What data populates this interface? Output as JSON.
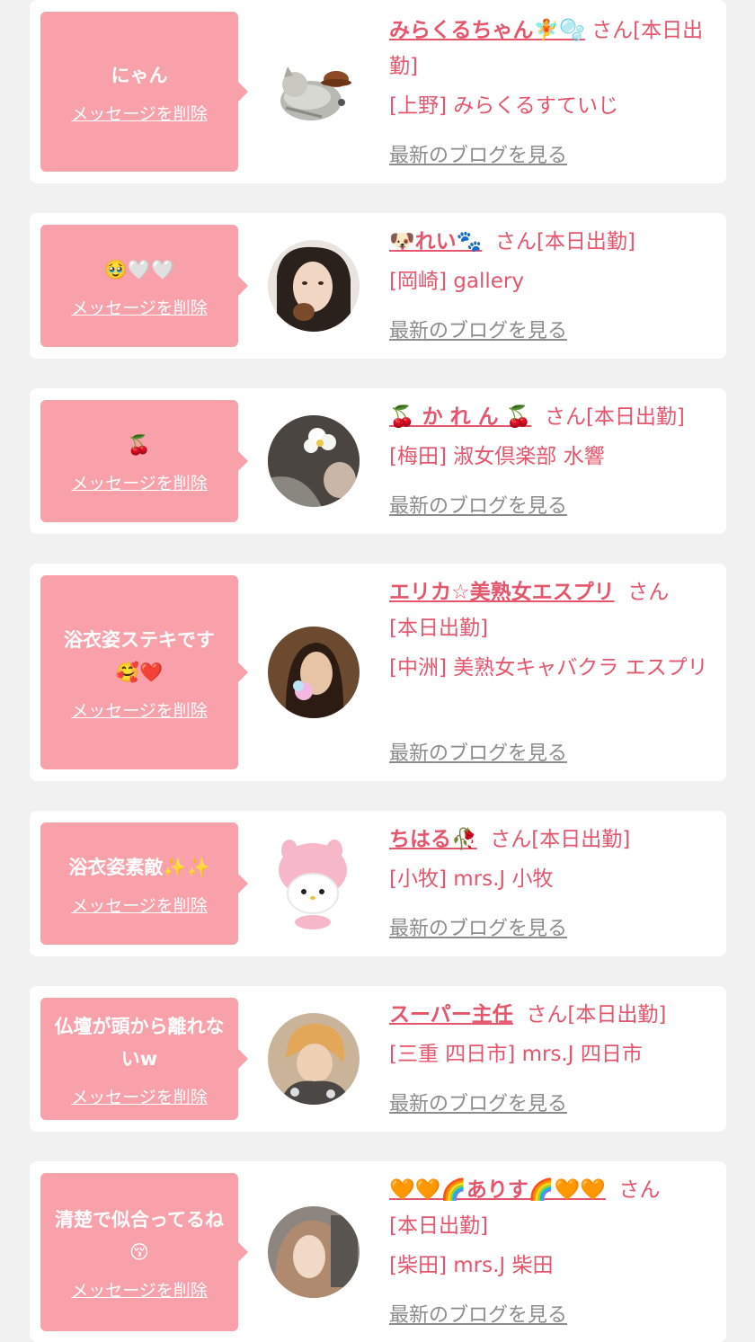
{
  "cards": [
    {
      "message": "にゃん",
      "delete_label": "メッセージを削除",
      "name": "みらくるちゃん",
      "name_emoji": "🧚🫧",
      "honorific": "さん",
      "status": "[本日出勤]",
      "shop": "[上野] みらくるすていじ",
      "blog_label": "最新のブログを見る"
    },
    {
      "message": "🥹🤍🤍",
      "delete_label": "メッセージを削除",
      "name_prefix": "🐶",
      "name": "れい",
      "name_emoji": "🐾",
      "honorific": "さん",
      "status": "[本日出勤]",
      "shop": "[岡崎] gallery",
      "blog_label": "最新のブログを見る"
    },
    {
      "message": "🍒",
      "delete_label": "メッセージを削除",
      "name_prefix": "🍒",
      "name": " か れ ん ",
      "name_emoji": "🍒",
      "honorific": "さん",
      "status": "[本日出勤]",
      "shop": "[梅田] 淑女倶楽部 水響",
      "blog_label": "最新のブログを見る"
    },
    {
      "message": "浴衣姿ステキです🥰❤️",
      "delete_label": "メッセージを削除",
      "name": "エリカ☆美熟女エスプリ",
      "honorific": "さん",
      "status": "[本日出勤]",
      "shop": "[中洲] 美熟女キャバクラ エスプリ",
      "blog_label": "最新のブログを見る"
    },
    {
      "message": "浴衣姿素敵✨✨",
      "delete_label": "メッセージを削除",
      "name": "ちはる",
      "name_emoji": "🥀",
      "honorific": "さん",
      "status": "[本日出勤]",
      "shop": "[小牧] mrs.J 小牧",
      "blog_label": "最新のブログを見る"
    },
    {
      "message": "仏壇が頭から離れないw",
      "delete_label": "メッセージを削除",
      "name": "スーパー主任",
      "honorific": "さん",
      "status": "[本日出勤]",
      "shop": "[三重 四日市] mrs.J 四日市",
      "blog_label": "最新のブログを見る"
    },
    {
      "message": "清楚で似合ってるね😚",
      "delete_label": "メッセージを削除",
      "name_prefix": "🧡🧡🌈",
      "name": "ありす",
      "name_emoji": "🌈🧡🧡",
      "honorific": "さん",
      "status": "[本日出勤]",
      "shop": "[柴田] mrs.J 柴田",
      "blog_label": "最新のブログを見る"
    }
  ],
  "colors": {
    "page_bg": "#f1f1f1",
    "card_bg": "#ffffff",
    "bubble_bg": "#f9a1ab",
    "accent_text": "#e5556b",
    "link_gray": "#8c8c8c"
  },
  "icons": [
    "cat-sticker-avatar",
    "photo-avatar",
    "plush-toy-avatar"
  ]
}
